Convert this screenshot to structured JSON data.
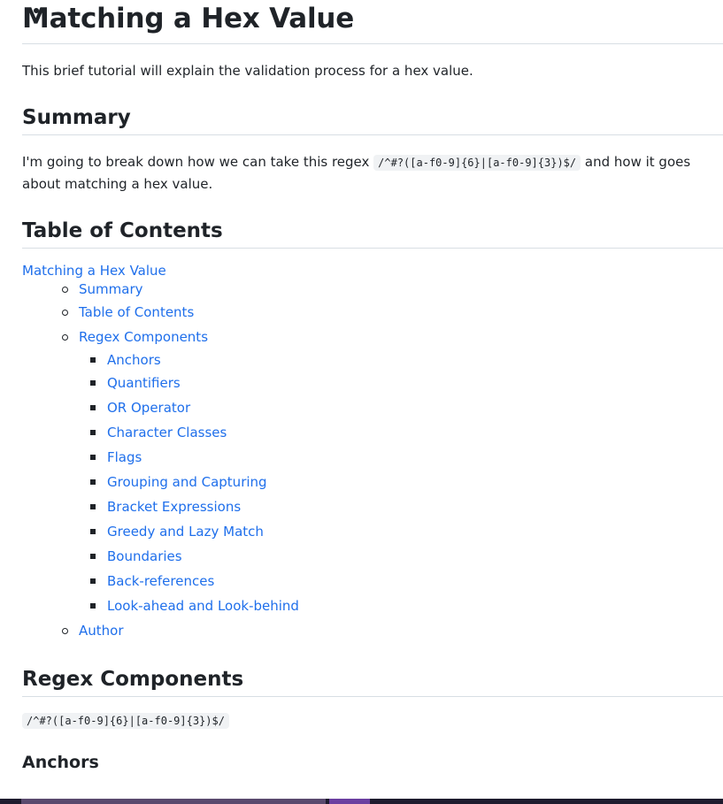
{
  "title": "Matching a Hex Value",
  "intro": "This brief tutorial will explain the validation process for a hex value.",
  "summary": {
    "heading": "Summary",
    "text_before": "I'm going to break down how we can take this regex ",
    "regex": "/^#?([a-f0-9]{6}|[a-f0-9]{3})$/",
    "text_after": " and how it goes about matching a hex value."
  },
  "toc": {
    "heading": "Table of Contents",
    "root": "Matching a Hex Value",
    "items": [
      "Summary",
      "Table of Contents",
      "Regex Components",
      "Author"
    ],
    "components": [
      "Anchors",
      "Quantifiers",
      "OR Operator",
      "Character Classes",
      "Flags",
      "Grouping and Capturing",
      "Bracket Expressions",
      "Greedy and Lazy Match",
      "Boundaries",
      "Back-references",
      "Look-ahead and Look-behind"
    ]
  },
  "regex_components": {
    "heading": "Regex Components",
    "regex": "/^#?([a-f0-9]{6}|[a-f0-9]{3})$/"
  },
  "anchors": {
    "heading": "Anchors"
  },
  "colors": {
    "link": "#1f6feb",
    "text": "#1f2328",
    "divider": "#d8dee4",
    "code_bg": "#f0f2f4"
  }
}
